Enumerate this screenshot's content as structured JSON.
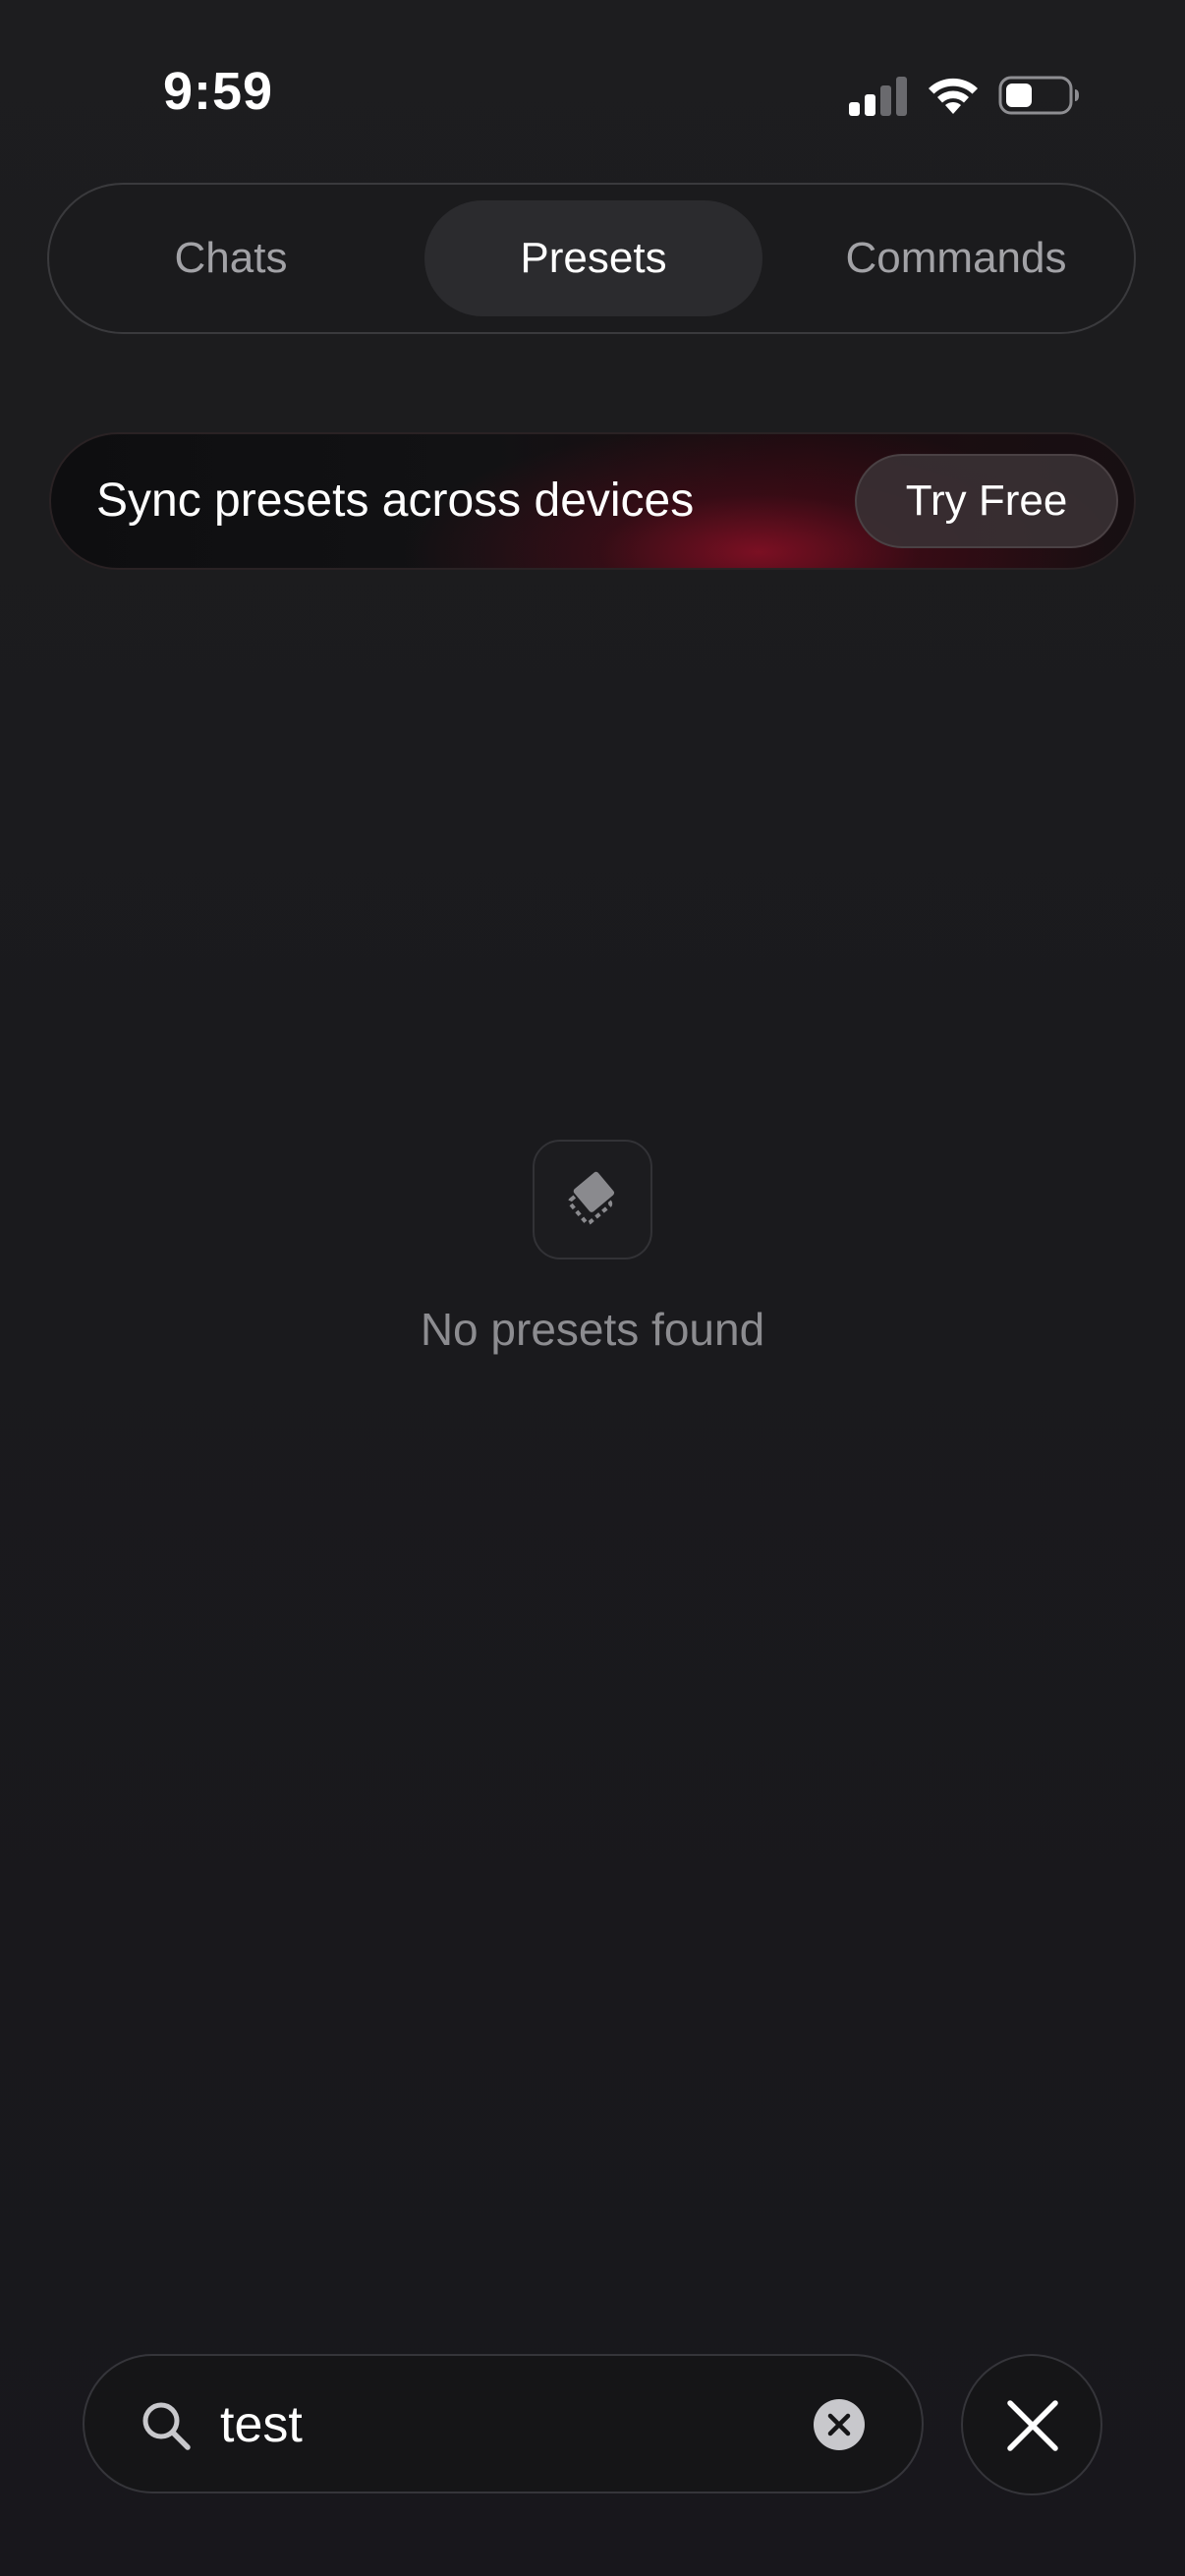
{
  "status_bar": {
    "time": "9:59",
    "icons": [
      "signal-icon",
      "wifi-icon",
      "battery-icon"
    ]
  },
  "tabs": [
    {
      "label": "Chats",
      "selected": false
    },
    {
      "label": "Presets",
      "selected": true
    },
    {
      "label": "Commands",
      "selected": false
    }
  ],
  "banner": {
    "text": "Sync presets across devices",
    "button_label": "Try Free",
    "accent_color": "#8c1026"
  },
  "empty_state": {
    "icon": "presets-icon",
    "message": "No presets found"
  },
  "search": {
    "value": "test",
    "icon": "search-icon",
    "clear_icon": "clear-icon",
    "close_icon": "close-icon"
  },
  "colors": {
    "background": "#1b1b1e",
    "text_primary": "#ffffff",
    "text_secondary": "#a2a2a6",
    "text_muted": "#8c8c90"
  }
}
